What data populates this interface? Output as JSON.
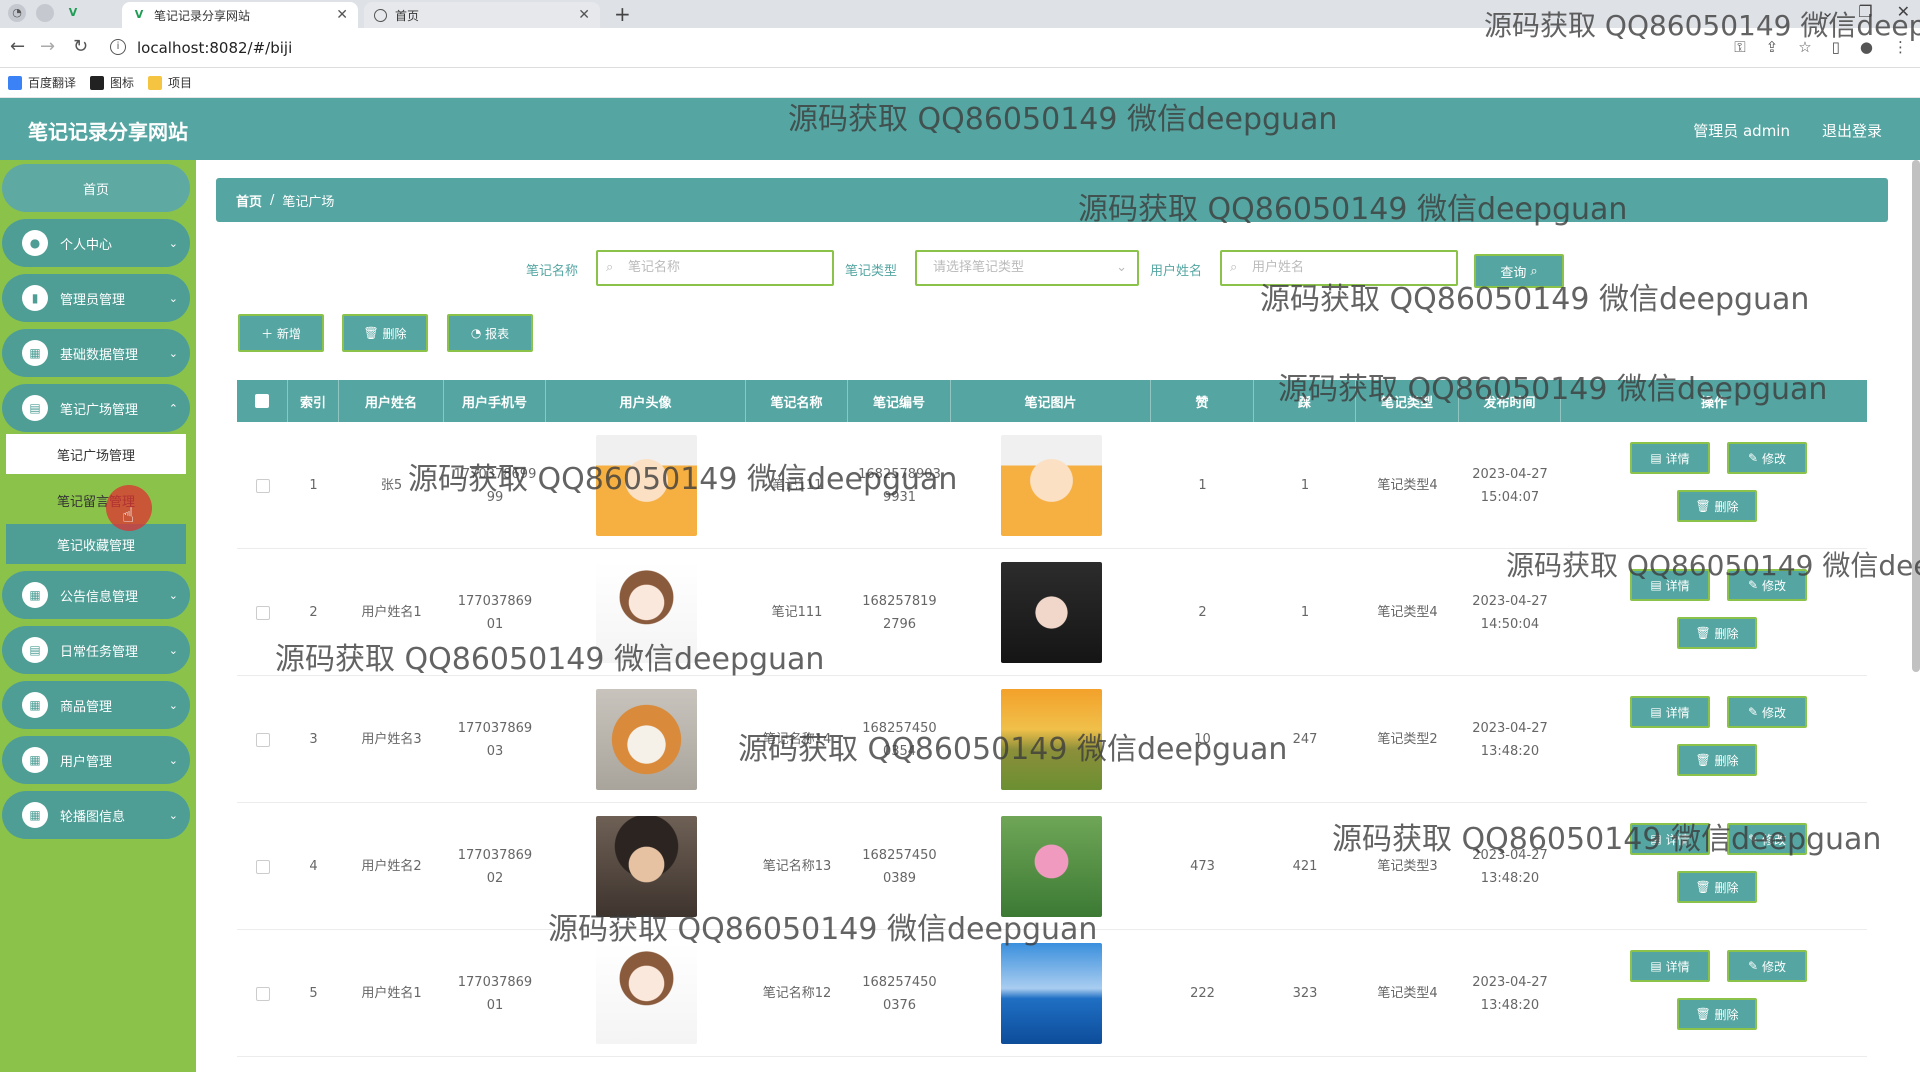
{
  "browser": {
    "tabs": [
      {
        "title": "笔记记录分享网站",
        "active": true
      },
      {
        "title": "首页",
        "active": false
      }
    ],
    "new_tab": "+",
    "url": "localhost:8082/#/biji",
    "bookmarks": [
      "百度翻译",
      "图标",
      "项目"
    ]
  },
  "header": {
    "title": "笔记记录分享网站",
    "user": "管理员 admin",
    "logout": "退出登录"
  },
  "sidebar": {
    "home": "首页",
    "items": [
      {
        "label": "个人中心",
        "icon": "user-icon"
      },
      {
        "label": "管理员管理",
        "icon": "chart-icon"
      },
      {
        "label": "基础数据管理",
        "icon": "grid-icon"
      },
      {
        "label": "笔记广场管理",
        "icon": "note-icon"
      },
      {
        "label": "公告信息管理",
        "icon": "grid-icon"
      },
      {
        "label": "日常任务管理",
        "icon": "note-icon"
      },
      {
        "label": "商品管理",
        "icon": "grid-icon"
      },
      {
        "label": "用户管理",
        "icon": "grid-icon"
      },
      {
        "label": "轮播图信息",
        "icon": "grid-icon"
      }
    ],
    "submenu": [
      "笔记广场管理",
      "笔记留言管理",
      "笔记收藏管理"
    ]
  },
  "breadcrumb": {
    "home": "首页",
    "separator": "/",
    "current": "笔记广场"
  },
  "search": {
    "name_label": "笔记名称",
    "name_placeholder": "笔记名称",
    "type_label": "笔记类型",
    "type_placeholder": "请选择笔记类型",
    "user_label": "用户姓名",
    "user_placeholder": "用户姓名",
    "query": "查询"
  },
  "actions": {
    "add": "新增",
    "delete": "删除",
    "report": "报表"
  },
  "table": {
    "columns": [
      "索引",
      "用户姓名",
      "用户手机号",
      "用户头像",
      "笔记名称",
      "笔记编号",
      "笔记图片",
      "赞",
      "踩",
      "笔记类型",
      "发布时间",
      "操作"
    ],
    "ops": {
      "detail": "详情",
      "edit": "修改",
      "delete": "删除"
    },
    "rows": [
      {
        "index": "1",
        "name": "张5",
        "phone": [
          "1770378699",
          "99"
        ],
        "avatar": "cartoon",
        "note": "笔记111",
        "no": [
          "1682578903",
          "9931"
        ],
        "img": "cartoon",
        "like": "1",
        "dislike": "1",
        "type": "笔记类型4",
        "time": [
          "2023-04-27",
          "15:04:07"
        ]
      },
      {
        "index": "2",
        "name": "用户姓名1",
        "phone": [
          "177037869",
          "01"
        ],
        "avatar": "girl",
        "note": "笔记111",
        "no": [
          "168257819",
          "2796"
        ],
        "img": "woman",
        "like": "2",
        "dislike": "1",
        "type": "笔记类型4",
        "time": [
          "2023-04-27",
          "14:50:04"
        ]
      },
      {
        "index": "3",
        "name": "用户姓名3",
        "phone": [
          "177037869",
          "03"
        ],
        "avatar": "dog",
        "note": "笔记名称14",
        "no": [
          "168257450",
          "0354"
        ],
        "img": "sunset",
        "like": "10",
        "dislike": "247",
        "type": "笔记类型2",
        "time": [
          "2023-04-27",
          "13:48:20"
        ]
      },
      {
        "index": "4",
        "name": "用户姓名2",
        "phone": [
          "177037869",
          "02"
        ],
        "avatar": "boy",
        "note": "笔记名称13",
        "no": [
          "168257450",
          "0389"
        ],
        "img": "lotus",
        "like": "473",
        "dislike": "421",
        "type": "笔记类型3",
        "time": [
          "2023-04-27",
          "13:48:20"
        ]
      },
      {
        "index": "5",
        "name": "用户姓名1",
        "phone": [
          "177037869",
          "01"
        ],
        "avatar": "girl",
        "note": "笔记名称12",
        "no": [
          "168257450",
          "0376"
        ],
        "img": "sea",
        "like": "222",
        "dislike": "323",
        "type": "笔记类型4",
        "time": [
          "2023-04-27",
          "13:48:20"
        ]
      }
    ]
  },
  "watermark": "源码获取 QQ86050149 微信deepguan",
  "colors": {
    "primary": "#55a6a2",
    "sidebar": "#8bc34a",
    "menu": "#4f9e96"
  }
}
